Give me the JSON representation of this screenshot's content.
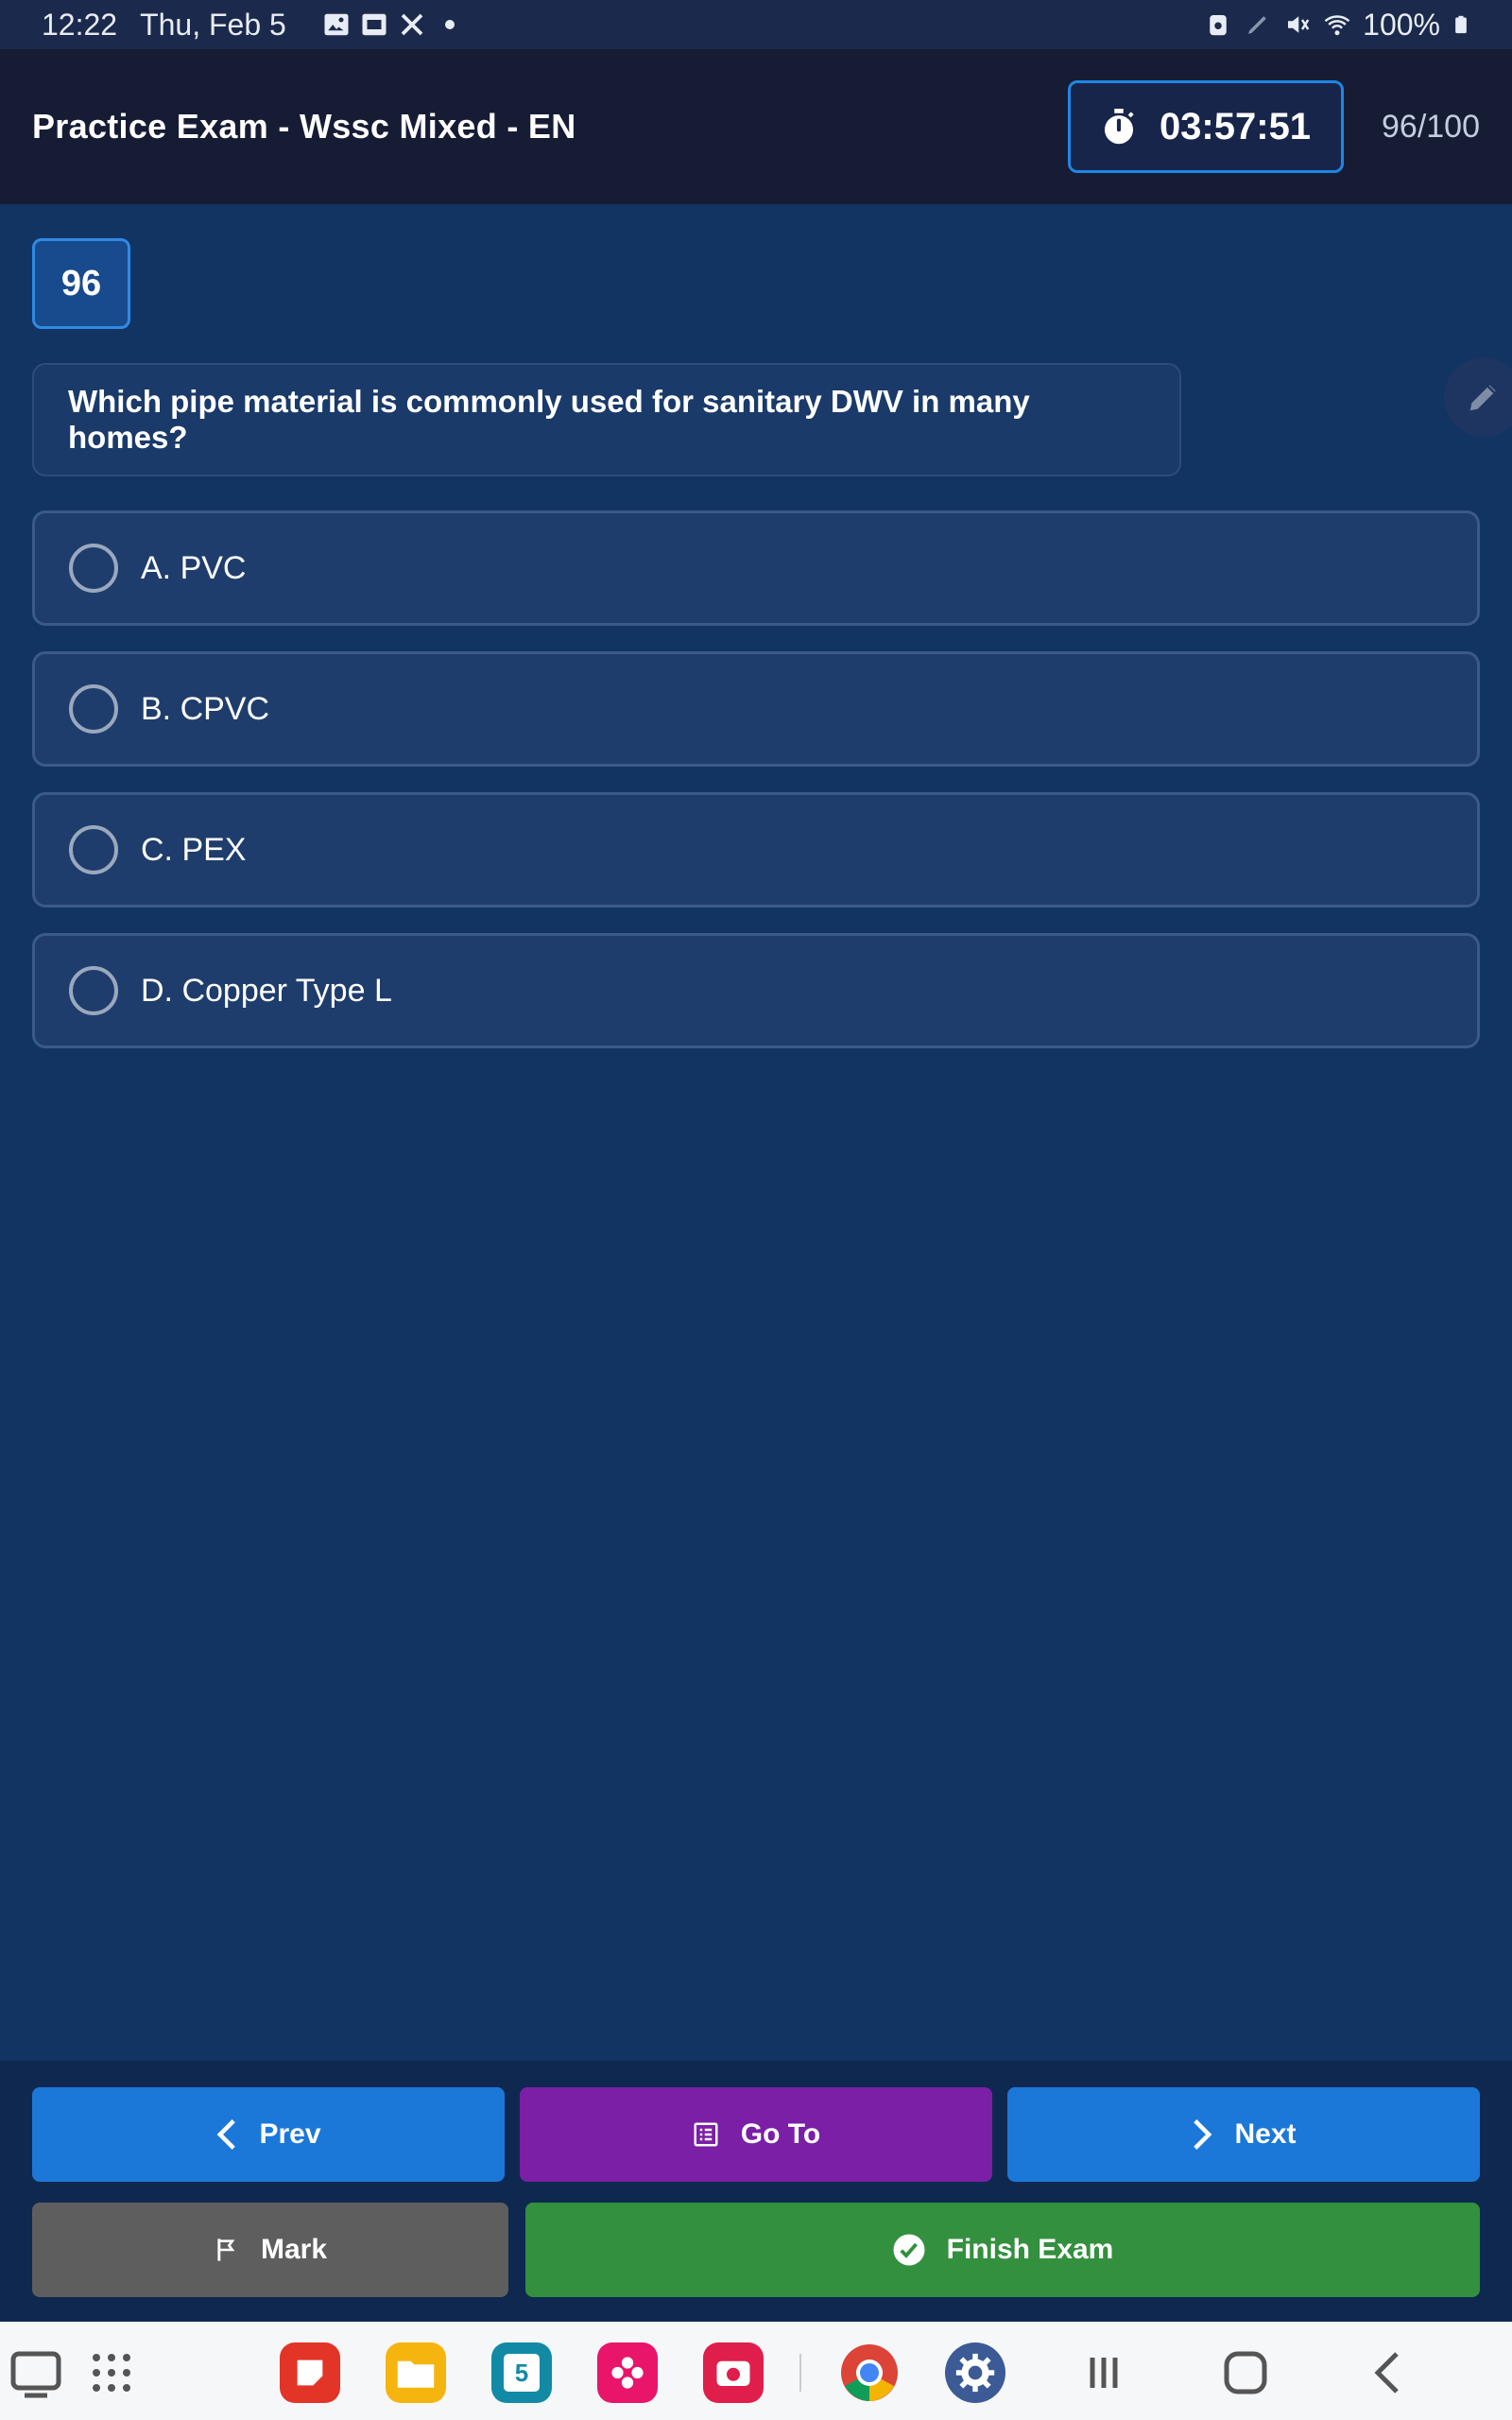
{
  "status_bar": {
    "time": "12:22",
    "date": "Thu, Feb 5",
    "battery": "100%",
    "icons": [
      "gallery-icon",
      "screenshot-icon",
      "tools-icon",
      "dot-icon",
      "lock-icon",
      "pen-icon",
      "mute-icon",
      "wifi-icon",
      "battery-icon"
    ]
  },
  "header": {
    "title": "Practice Exam - Wssc Mixed - EN",
    "timer": "03:57:51",
    "progress": "96/100"
  },
  "question": {
    "number": "96",
    "text": "Which pipe material is commonly used for sanitary DWV in many homes?",
    "options": [
      {
        "label": "A. PVC",
        "selected": false
      },
      {
        "label": "B. CPVC",
        "selected": false
      },
      {
        "label": "C. PEX",
        "selected": false
      },
      {
        "label": "D. Copper Type L",
        "selected": false
      }
    ]
  },
  "buttons": {
    "prev": "Prev",
    "goto": "Go To",
    "next": "Next",
    "mark": "Mark",
    "finish": "Finish Exam"
  },
  "colors": {
    "background": "#123463",
    "header": "#161c34",
    "accent_blue": "#1c78d8",
    "purple": "#7a1fa6",
    "green": "#33903e",
    "gray": "#5e5e5e"
  },
  "nav_bar": {
    "apps": [
      "notes-app-icon",
      "files-app-icon",
      "calendar-app-icon",
      "flower-app-icon",
      "camera-app-icon",
      "chrome-app-icon",
      "settings-app-icon"
    ],
    "calendar_day": "5",
    "controls": [
      "recents-icon",
      "home-icon",
      "back-icon"
    ]
  }
}
